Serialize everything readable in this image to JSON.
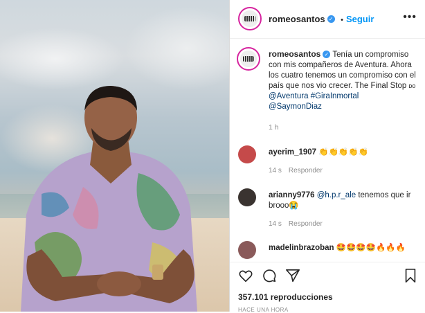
{
  "post": {
    "username": "romeosantos",
    "follow_label": "Seguir",
    "separator": "•",
    "caption_text": "Tenía un compromiso con mis compañeros de Aventura. Ahora los cuatro tenemos un compromiso con el país que nos vio crecer. The Final Stop ",
    "caption_emoji": "ᴅᴏ",
    "mentions": [
      "@Aventura",
      "#GiraInmortal",
      "@SaymonDiaz"
    ],
    "time": "1 h"
  },
  "comments": [
    {
      "user": "ayerim_1907",
      "text": "👏👏👏👏👏",
      "age": "14 s",
      "reply": "Responder",
      "avatar_color": "#c54a4a"
    },
    {
      "user": "arianny9776",
      "mention": "@h.p.r_ale",
      "text": " tenemos que ir brooo😭",
      "age": "14 s",
      "reply": "Responder",
      "avatar_color": "#3a3330"
    },
    {
      "user": "madelinbrazoban",
      "text": "🤩🤩🤩🤩🔥🔥🔥",
      "age": "",
      "reply": "",
      "avatar_color": "#8a5a5a"
    }
  ],
  "footer": {
    "views": "357.101 reproducciones",
    "ago": "HACE UNA HORA"
  },
  "icons": [
    "heart-icon",
    "comment-icon",
    "share-icon",
    "bookmark-icon"
  ],
  "colors": {
    "follow": "#0095f6",
    "verified": "#3897f0",
    "link": "#00376b"
  }
}
